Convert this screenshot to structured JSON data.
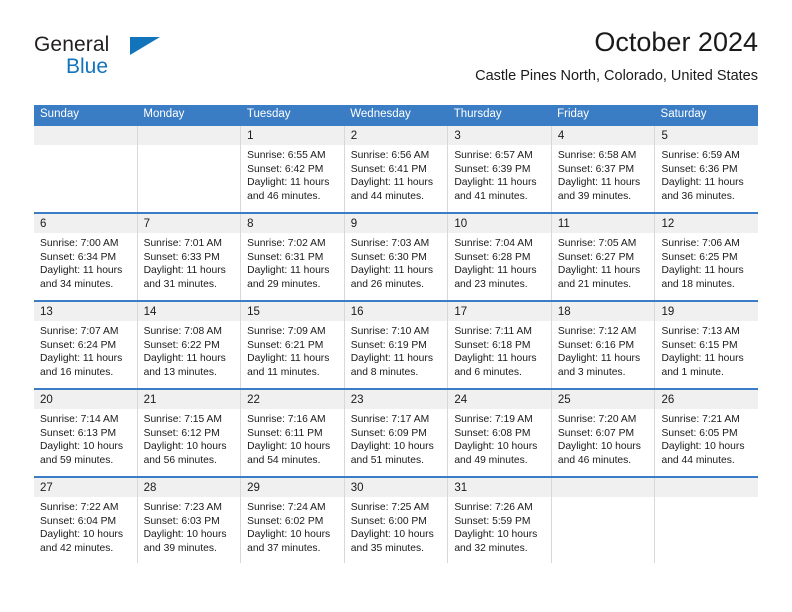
{
  "logo": {
    "line1": "General",
    "line2": "Blue",
    "accent_color": "#1275bc"
  },
  "header": {
    "title": "October 2024",
    "subtitle": "Castle Pines North, Colorado, United States"
  },
  "theme": {
    "header_blue": "#3b7dc4",
    "day_band_gray": "#f0f0f0",
    "grid_line": "#d8d8d8"
  },
  "calendar": {
    "day_headers": [
      "Sunday",
      "Monday",
      "Tuesday",
      "Wednesday",
      "Thursday",
      "Friday",
      "Saturday"
    ],
    "weeks": [
      [
        {
          "day": "",
          "sunrise": "",
          "sunset": "",
          "daylight_line1": "",
          "daylight_line2": ""
        },
        {
          "day": "",
          "sunrise": "",
          "sunset": "",
          "daylight_line1": "",
          "daylight_line2": ""
        },
        {
          "day": "1",
          "sunrise": "Sunrise: 6:55 AM",
          "sunset": "Sunset: 6:42 PM",
          "daylight_line1": "Daylight: 11 hours",
          "daylight_line2": "and 46 minutes."
        },
        {
          "day": "2",
          "sunrise": "Sunrise: 6:56 AM",
          "sunset": "Sunset: 6:41 PM",
          "daylight_line1": "Daylight: 11 hours",
          "daylight_line2": "and 44 minutes."
        },
        {
          "day": "3",
          "sunrise": "Sunrise: 6:57 AM",
          "sunset": "Sunset: 6:39 PM",
          "daylight_line1": "Daylight: 11 hours",
          "daylight_line2": "and 41 minutes."
        },
        {
          "day": "4",
          "sunrise": "Sunrise: 6:58 AM",
          "sunset": "Sunset: 6:37 PM",
          "daylight_line1": "Daylight: 11 hours",
          "daylight_line2": "and 39 minutes."
        },
        {
          "day": "5",
          "sunrise": "Sunrise: 6:59 AM",
          "sunset": "Sunset: 6:36 PM",
          "daylight_line1": "Daylight: 11 hours",
          "daylight_line2": "and 36 minutes."
        }
      ],
      [
        {
          "day": "6",
          "sunrise": "Sunrise: 7:00 AM",
          "sunset": "Sunset: 6:34 PM",
          "daylight_line1": "Daylight: 11 hours",
          "daylight_line2": "and 34 minutes."
        },
        {
          "day": "7",
          "sunrise": "Sunrise: 7:01 AM",
          "sunset": "Sunset: 6:33 PM",
          "daylight_line1": "Daylight: 11 hours",
          "daylight_line2": "and 31 minutes."
        },
        {
          "day": "8",
          "sunrise": "Sunrise: 7:02 AM",
          "sunset": "Sunset: 6:31 PM",
          "daylight_line1": "Daylight: 11 hours",
          "daylight_line2": "and 29 minutes."
        },
        {
          "day": "9",
          "sunrise": "Sunrise: 7:03 AM",
          "sunset": "Sunset: 6:30 PM",
          "daylight_line1": "Daylight: 11 hours",
          "daylight_line2": "and 26 minutes."
        },
        {
          "day": "10",
          "sunrise": "Sunrise: 7:04 AM",
          "sunset": "Sunset: 6:28 PM",
          "daylight_line1": "Daylight: 11 hours",
          "daylight_line2": "and 23 minutes."
        },
        {
          "day": "11",
          "sunrise": "Sunrise: 7:05 AM",
          "sunset": "Sunset: 6:27 PM",
          "daylight_line1": "Daylight: 11 hours",
          "daylight_line2": "and 21 minutes."
        },
        {
          "day": "12",
          "sunrise": "Sunrise: 7:06 AM",
          "sunset": "Sunset: 6:25 PM",
          "daylight_line1": "Daylight: 11 hours",
          "daylight_line2": "and 18 minutes."
        }
      ],
      [
        {
          "day": "13",
          "sunrise": "Sunrise: 7:07 AM",
          "sunset": "Sunset: 6:24 PM",
          "daylight_line1": "Daylight: 11 hours",
          "daylight_line2": "and 16 minutes."
        },
        {
          "day": "14",
          "sunrise": "Sunrise: 7:08 AM",
          "sunset": "Sunset: 6:22 PM",
          "daylight_line1": "Daylight: 11 hours",
          "daylight_line2": "and 13 minutes."
        },
        {
          "day": "15",
          "sunrise": "Sunrise: 7:09 AM",
          "sunset": "Sunset: 6:21 PM",
          "daylight_line1": "Daylight: 11 hours",
          "daylight_line2": "and 11 minutes."
        },
        {
          "day": "16",
          "sunrise": "Sunrise: 7:10 AM",
          "sunset": "Sunset: 6:19 PM",
          "daylight_line1": "Daylight: 11 hours",
          "daylight_line2": "and 8 minutes."
        },
        {
          "day": "17",
          "sunrise": "Sunrise: 7:11 AM",
          "sunset": "Sunset: 6:18 PM",
          "daylight_line1": "Daylight: 11 hours",
          "daylight_line2": "and 6 minutes."
        },
        {
          "day": "18",
          "sunrise": "Sunrise: 7:12 AM",
          "sunset": "Sunset: 6:16 PM",
          "daylight_line1": "Daylight: 11 hours",
          "daylight_line2": "and 3 minutes."
        },
        {
          "day": "19",
          "sunrise": "Sunrise: 7:13 AM",
          "sunset": "Sunset: 6:15 PM",
          "daylight_line1": "Daylight: 11 hours",
          "daylight_line2": "and 1 minute."
        }
      ],
      [
        {
          "day": "20",
          "sunrise": "Sunrise: 7:14 AM",
          "sunset": "Sunset: 6:13 PM",
          "daylight_line1": "Daylight: 10 hours",
          "daylight_line2": "and 59 minutes."
        },
        {
          "day": "21",
          "sunrise": "Sunrise: 7:15 AM",
          "sunset": "Sunset: 6:12 PM",
          "daylight_line1": "Daylight: 10 hours",
          "daylight_line2": "and 56 minutes."
        },
        {
          "day": "22",
          "sunrise": "Sunrise: 7:16 AM",
          "sunset": "Sunset: 6:11 PM",
          "daylight_line1": "Daylight: 10 hours",
          "daylight_line2": "and 54 minutes."
        },
        {
          "day": "23",
          "sunrise": "Sunrise: 7:17 AM",
          "sunset": "Sunset: 6:09 PM",
          "daylight_line1": "Daylight: 10 hours",
          "daylight_line2": "and 51 minutes."
        },
        {
          "day": "24",
          "sunrise": "Sunrise: 7:19 AM",
          "sunset": "Sunset: 6:08 PM",
          "daylight_line1": "Daylight: 10 hours",
          "daylight_line2": "and 49 minutes."
        },
        {
          "day": "25",
          "sunrise": "Sunrise: 7:20 AM",
          "sunset": "Sunset: 6:07 PM",
          "daylight_line1": "Daylight: 10 hours",
          "daylight_line2": "and 46 minutes."
        },
        {
          "day": "26",
          "sunrise": "Sunrise: 7:21 AM",
          "sunset": "Sunset: 6:05 PM",
          "daylight_line1": "Daylight: 10 hours",
          "daylight_line2": "and 44 minutes."
        }
      ],
      [
        {
          "day": "27",
          "sunrise": "Sunrise: 7:22 AM",
          "sunset": "Sunset: 6:04 PM",
          "daylight_line1": "Daylight: 10 hours",
          "daylight_line2": "and 42 minutes."
        },
        {
          "day": "28",
          "sunrise": "Sunrise: 7:23 AM",
          "sunset": "Sunset: 6:03 PM",
          "daylight_line1": "Daylight: 10 hours",
          "daylight_line2": "and 39 minutes."
        },
        {
          "day": "29",
          "sunrise": "Sunrise: 7:24 AM",
          "sunset": "Sunset: 6:02 PM",
          "daylight_line1": "Daylight: 10 hours",
          "daylight_line2": "and 37 minutes."
        },
        {
          "day": "30",
          "sunrise": "Sunrise: 7:25 AM",
          "sunset": "Sunset: 6:00 PM",
          "daylight_line1": "Daylight: 10 hours",
          "daylight_line2": "and 35 minutes."
        },
        {
          "day": "31",
          "sunrise": "Sunrise: 7:26 AM",
          "sunset": "Sunset: 5:59 PM",
          "daylight_line1": "Daylight: 10 hours",
          "daylight_line2": "and 32 minutes."
        },
        {
          "day": "",
          "sunrise": "",
          "sunset": "",
          "daylight_line1": "",
          "daylight_line2": ""
        },
        {
          "day": "",
          "sunrise": "",
          "sunset": "",
          "daylight_line1": "",
          "daylight_line2": ""
        }
      ]
    ]
  }
}
